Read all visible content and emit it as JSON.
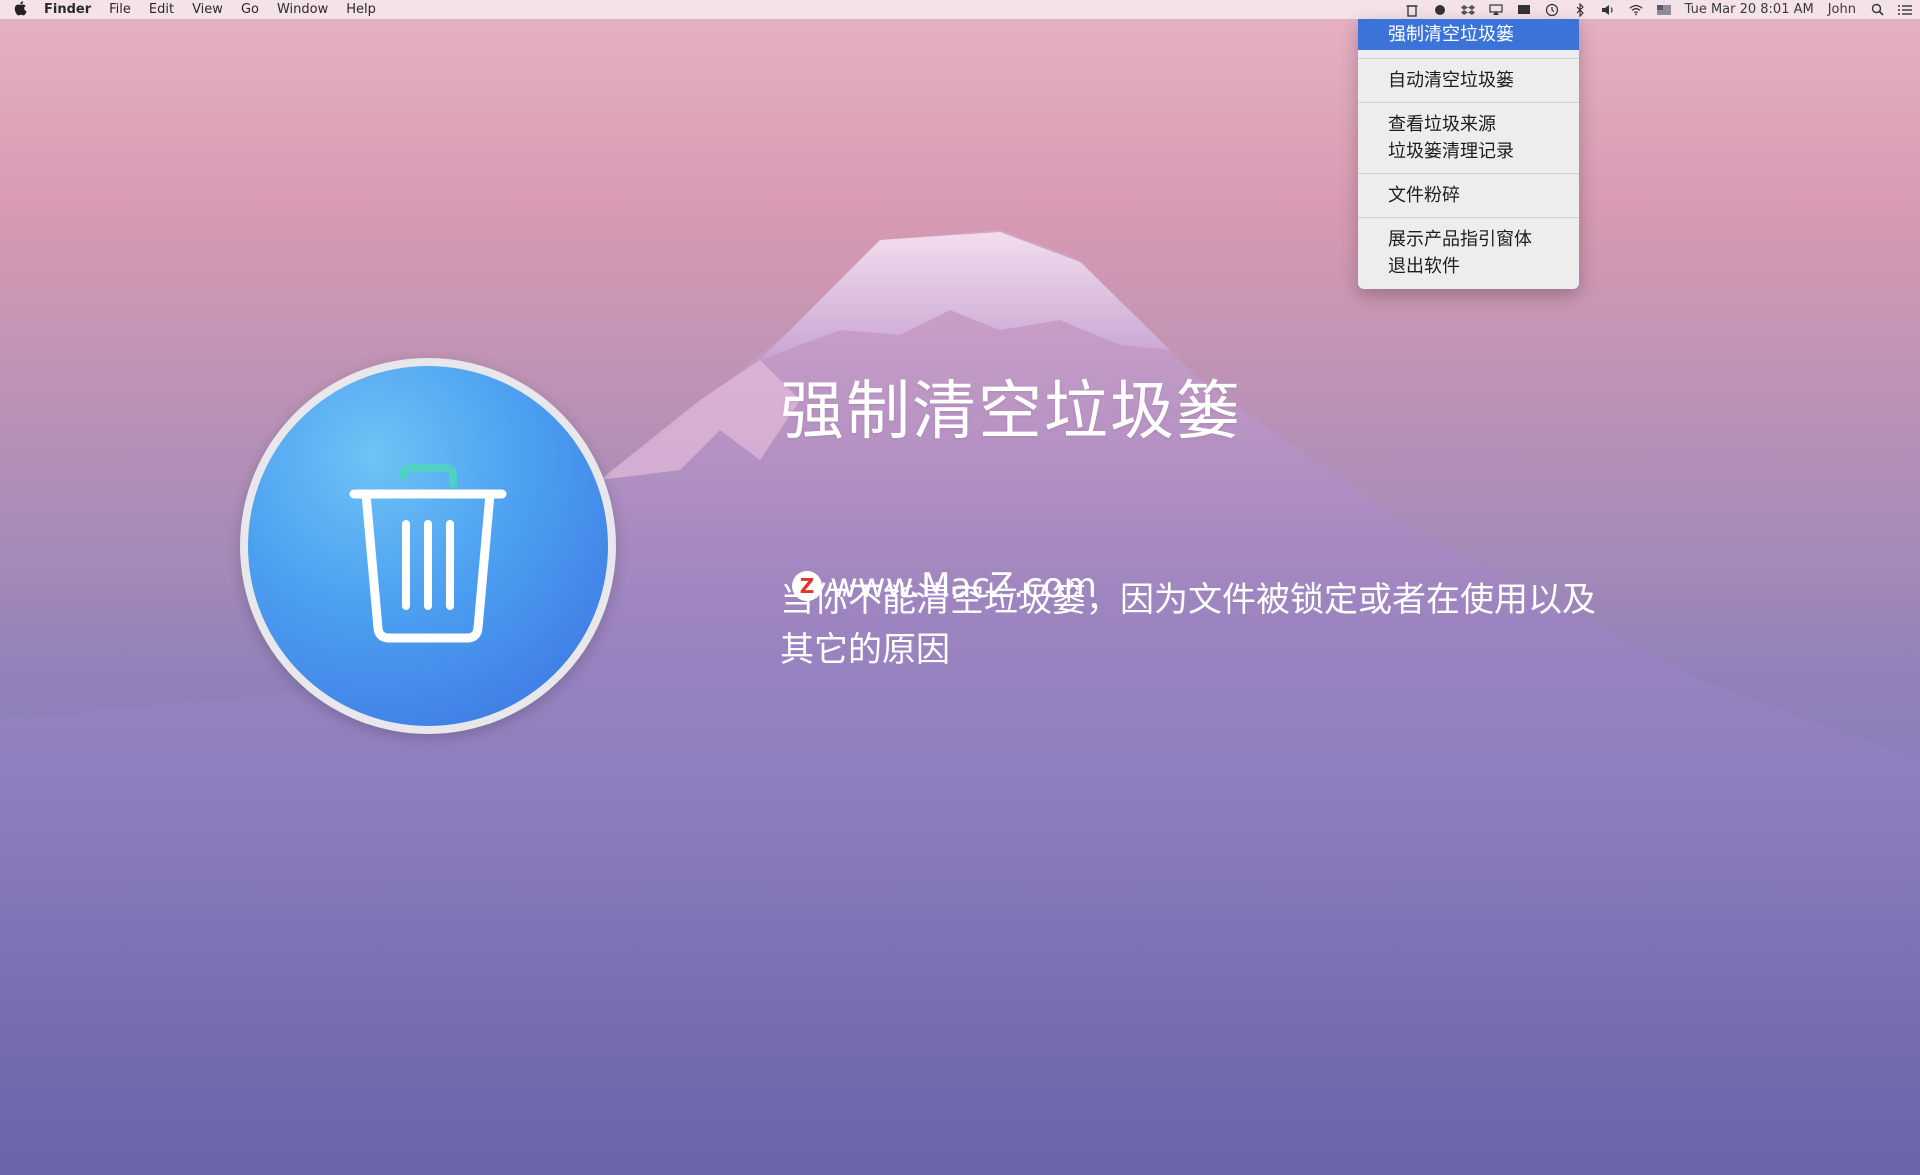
{
  "menubar": {
    "app_name": "Finder",
    "menus": [
      "File",
      "Edit",
      "View",
      "Go",
      "Window",
      "Help"
    ],
    "clock": "Tue Mar 20  8:01 AM",
    "user": "John"
  },
  "dropdown": {
    "items": [
      "强制清空垃圾篓",
      "自动清空垃圾篓",
      "查看垃圾来源",
      "垃圾篓清理记录",
      "文件粉碎",
      "展示产品指引窗体",
      "退出软件"
    ],
    "highlight_color": "#3b73d9"
  },
  "content": {
    "title": "强制清空垃圾篓",
    "description": "当你不能清空垃圾篓，因为文件被锁定或者在使用以及其它的原因",
    "watermark": "www.MacZ.com",
    "watermark_badge": "Z"
  },
  "colors": {
    "icon_gradient_top": "#6ec3f5",
    "icon_gradient_bottom": "#3b6fe0"
  }
}
